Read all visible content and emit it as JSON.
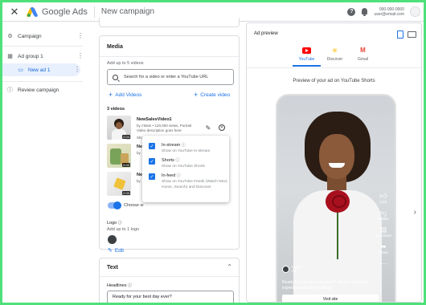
{
  "header": {
    "close_icon": "close-icon",
    "brand": "Google Ads",
    "campaign": "New campaign",
    "account_id": "000-000-0000",
    "account_email": "user@email.com"
  },
  "nav": {
    "items": [
      {
        "label": "Campaign",
        "icon": "gear-icon"
      },
      {
        "label": "Ad group 1",
        "icon": "grid-icon"
      },
      {
        "label": "New ad 1",
        "icon": "ad-icon"
      },
      {
        "label": "Review campaign",
        "icon": "info-icon"
      }
    ]
  },
  "media": {
    "title": "Media",
    "hint": "Add up to 5 videos",
    "search_placeholder": "Search for a video or enter a YouTube URL",
    "add_videos": "Add Videos",
    "create_video": "Create video",
    "count": "3 videos",
    "video": {
      "title": "NewSalesVideo1",
      "meta1": "by c'Bam • 120,000 views, Portrait",
      "meta2": "Video description goes here",
      "duration": "0:30",
      "show_on_prefix": "Show on:",
      "show_on_value": "All formats"
    },
    "thumb2_title": "Ne",
    "thumb2_sub": "by",
    "thumb3_title": "Ne",
    "thumb3_sub": "by",
    "dur2": "0:30",
    "dur3": "0:30",
    "choose_label": "Choose w",
    "logo_title": "Logo",
    "logo_hint": "Add up to 1 logo",
    "edit_label": "Edit"
  },
  "popover": {
    "options": [
      {
        "title": "In-stream",
        "desc": "Show on YouTube In-stream",
        "checked": true
      },
      {
        "title": "Shorts",
        "desc": "Show on YouTube Shorts",
        "checked": true
      },
      {
        "title": "In-feed",
        "desc": "Show on YouTube Feeds (Watch Next, Home, Search) and Discover",
        "checked": true
      }
    ]
  },
  "text_card": {
    "title": "Text",
    "headlines_label": "Headlines",
    "headline_value": "Ready for your best day ever?"
  },
  "preview": {
    "title": "Ad preview",
    "tabs": [
      {
        "label": "YouTube",
        "icon": "youtube-icon",
        "active": true
      },
      {
        "label": "Discover",
        "icon": "discover-icon",
        "active": false
      },
      {
        "label": "Gmail",
        "icon": "gmail-icon",
        "active": false
      }
    ],
    "caption": "Preview of your ad on YouTube Shorts",
    "actions": [
      {
        "label": "4.2K",
        "icon": "thumbs-up-icon"
      },
      {
        "label": "Dislike",
        "icon": "thumbs-down-icon"
      },
      {
        "label": "Comment",
        "icon": "comment-icon"
      },
      {
        "label": "Share",
        "icon": "share-icon"
      },
      {
        "label": "",
        "icon": "more-icon"
      }
    ],
    "channel_name": "c'Bam",
    "channel_tag": "Ad",
    "ad_text": "Ready for your best day ever? cBam's all natural ingredients are here to help",
    "cta": "Visit site"
  },
  "colors": {
    "accent": "#1a73e8",
    "frame_border": "#4fe07a"
  }
}
